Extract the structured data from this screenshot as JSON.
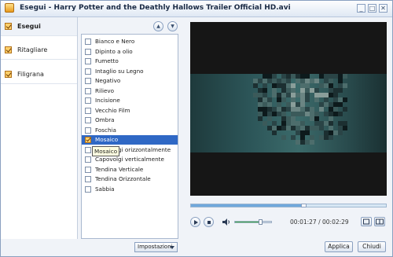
{
  "window": {
    "title": "Esegui - Harry Potter and the Deathly Hallows Trailer Official HD.avi",
    "minimize": "_",
    "maximize": "□",
    "close": "✕"
  },
  "sidebar": {
    "items": [
      {
        "label": "Esegui",
        "active": true
      },
      {
        "label": "Ritagliare",
        "active": false
      },
      {
        "label": "Filigrana",
        "active": false
      }
    ]
  },
  "effects": {
    "up_glyph": "▲",
    "down_glyph": "▼",
    "items": [
      {
        "label": "Bianco e Nero",
        "checked": false
      },
      {
        "label": "Dipinto a olio",
        "checked": false
      },
      {
        "label": "Fumetto",
        "checked": false
      },
      {
        "label": "Intaglio su Legno",
        "checked": false
      },
      {
        "label": "Negativo",
        "checked": false
      },
      {
        "label": "Rilievo",
        "checked": false
      },
      {
        "label": "Incisione",
        "checked": false
      },
      {
        "label": "Vecchio Film",
        "checked": false
      },
      {
        "label": "Ombra",
        "checked": false
      },
      {
        "label": "Foschia",
        "checked": false
      },
      {
        "label": "Mosaico",
        "checked": true
      },
      {
        "label": "Capovolgi orizzontalmente",
        "checked": false
      },
      {
        "label": "Capovolgi verticalmente",
        "checked": false
      },
      {
        "label": "Tendina Verticale",
        "checked": false
      },
      {
        "label": "Tendina Orizzontale",
        "checked": false
      },
      {
        "label": "Sabbia",
        "checked": false
      }
    ],
    "tooltip": "Mosaico",
    "settings_button": "Impostazioni"
  },
  "player": {
    "timeline_progress": 0.575,
    "volume_level": 0.7,
    "time_current": "00:01:27",
    "time_total": "00:02:29",
    "time_separator": "/"
  },
  "buttons": {
    "apply": "Applica",
    "close": "Chiudi"
  },
  "colors": {
    "accent": "#2f68c5",
    "volume": "#3aa845",
    "timeline": "#6fa8dc"
  }
}
